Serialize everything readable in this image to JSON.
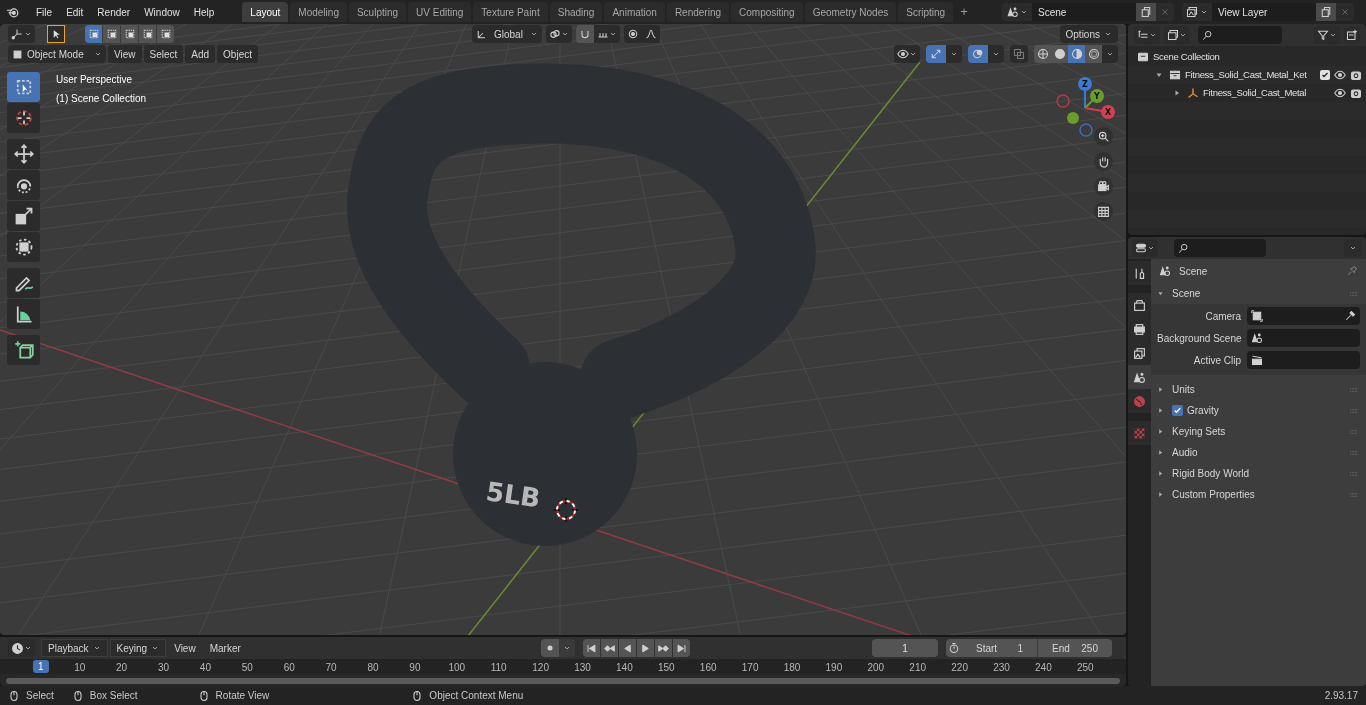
{
  "menu": [
    "File",
    "Edit",
    "Render",
    "Window",
    "Help"
  ],
  "workspaces": [
    {
      "label": "Layout",
      "selected": true
    },
    {
      "label": "Modeling",
      "selected": false
    },
    {
      "label": "Sculpting",
      "selected": false
    },
    {
      "label": "UV Editing",
      "selected": false
    },
    {
      "label": "Texture Paint",
      "selected": false
    },
    {
      "label": "Shading",
      "selected": false
    },
    {
      "label": "Animation",
      "selected": false
    },
    {
      "label": "Rendering",
      "selected": false
    },
    {
      "label": "Compositing",
      "selected": false
    },
    {
      "label": "Geometry Nodes",
      "selected": false
    },
    {
      "label": "Scripting",
      "selected": false
    }
  ],
  "add_workspace": "+",
  "scene_field": {
    "value": "Scene"
  },
  "view_layer_field": {
    "value": "View Layer"
  },
  "tool_header": {
    "select_modes": [
      {
        "selected": true
      },
      {
        "selected": false
      },
      {
        "selected": false
      },
      {
        "selected": false
      },
      {
        "selected": false
      }
    ],
    "orientation": "Global",
    "options": "Options"
  },
  "viewport_header": {
    "mode": "Object Mode",
    "menus": [
      "View",
      "Select",
      "Add",
      "Object"
    ],
    "shading_modes": [
      {
        "kind": "wireframe",
        "selected": false
      },
      {
        "kind": "solid",
        "selected": false
      },
      {
        "kind": "material",
        "selected": true
      },
      {
        "kind": "rendered",
        "selected": false
      }
    ]
  },
  "viewport": {
    "overlay_lines": [
      "User Perspective",
      "(1) Scene Collection"
    ],
    "model_label": "5LB",
    "gizmo_axes": [
      "Z",
      "Y",
      "X"
    ]
  },
  "toolbar": [
    {
      "kind": "select",
      "selected": true
    },
    {
      "kind": "cursor",
      "selected": false
    },
    {
      "kind": "move",
      "selected": false
    },
    {
      "kind": "rotate",
      "selected": false
    },
    {
      "kind": "scale",
      "selected": false
    },
    {
      "kind": "transform",
      "selected": false
    },
    {
      "kind": "annotate",
      "selected": false
    },
    {
      "kind": "measure",
      "selected": false
    },
    {
      "kind": "add_cube",
      "selected": false
    }
  ],
  "outliner": {
    "items": [
      {
        "label": "Scene Collection",
        "kind": "scene",
        "children": [
          {
            "label": "Fitness_Solid_Cast_Metal_Ket",
            "kind": "collection",
            "expanded": true,
            "checked": true,
            "children": [
              {
                "label": "Fitness_Solid_Cast_Metal",
                "kind": "object",
                "expanded": false
              }
            ]
          }
        ]
      }
    ]
  },
  "properties": {
    "tabs": [
      {
        "kind": "tool",
        "selected": false
      },
      {
        "kind": "render",
        "selected": false
      },
      {
        "kind": "output",
        "selected": false
      },
      {
        "kind": "view_layer",
        "selected": false
      },
      {
        "kind": "scene",
        "selected": true
      },
      {
        "kind": "world",
        "selected": false
      },
      {
        "kind": "texture",
        "selected": false
      }
    ],
    "context": "Scene",
    "panels": [
      {
        "label": "Scene",
        "expanded": true,
        "fields": [
          {
            "label": "Camera",
            "kind": "camera"
          },
          {
            "label": "Background Scene",
            "kind": "scene"
          },
          {
            "label": "Active Clip",
            "kind": "clip"
          }
        ]
      },
      {
        "label": "Units",
        "expanded": false
      },
      {
        "label": "Gravity",
        "expanded": false,
        "checked": true
      },
      {
        "label": "Keying Sets",
        "expanded": false
      },
      {
        "label": "Audio",
        "expanded": false
      },
      {
        "label": "Rigid Body World",
        "expanded": false
      },
      {
        "label": "Custom Properties",
        "expanded": false
      }
    ]
  },
  "timeline": {
    "menus": [
      "Playback",
      "Keying",
      "View",
      "Marker"
    ],
    "current_frame": "1",
    "start_label": "Start",
    "start": "1",
    "end_label": "End",
    "end": "250",
    "playhead": "1",
    "ticks": [
      "10",
      "20",
      "30",
      "40",
      "50",
      "60",
      "70",
      "80",
      "90",
      "100",
      "110",
      "120",
      "130",
      "140",
      "150",
      "160",
      "170",
      "180",
      "190",
      "200",
      "210",
      "220",
      "230",
      "240",
      "250"
    ]
  },
  "status_bar": {
    "hints": [
      "Select",
      "Box Select",
      "Rotate View",
      "Object Context Menu"
    ],
    "version": "2.93.17"
  }
}
